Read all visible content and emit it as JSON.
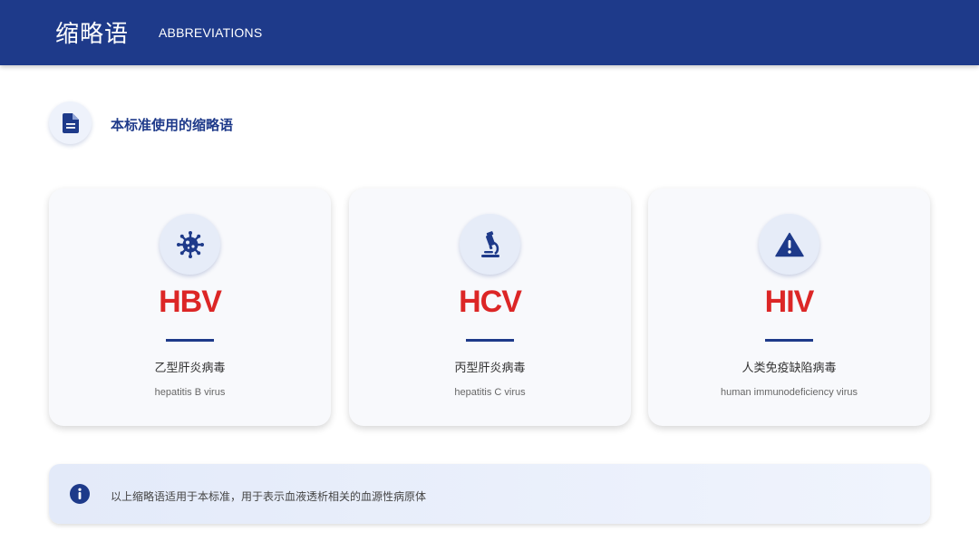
{
  "header": {
    "title": "缩略语",
    "subtitle": "ABBREVIATIONS"
  },
  "section": {
    "icon": "document-icon",
    "title": "本标准使用的缩略语"
  },
  "cards": [
    {
      "abbr": "HBV",
      "name_cn": "乙型肝炎病毒",
      "name_en": "hepatitis B virus",
      "icon": "virus-icon"
    },
    {
      "abbr": "HCV",
      "name_cn": "丙型肝炎病毒",
      "name_en": "hepatitis C virus",
      "icon": "microscope-icon"
    },
    {
      "abbr": "HIV",
      "name_cn": "人类免疫缺陷病毒",
      "name_en": "human immunodeficiency virus",
      "icon": "warning-icon"
    }
  ],
  "note": {
    "icon": "info-icon",
    "text": "以上缩略语适用于本标准，用于表示血液透析相关的血源性病原体"
  },
  "colors": {
    "primary": "#1e3a8a",
    "accent": "#dc2626",
    "card_bg": "#f8f9fc",
    "icon_bg": "#e6ecf8"
  }
}
